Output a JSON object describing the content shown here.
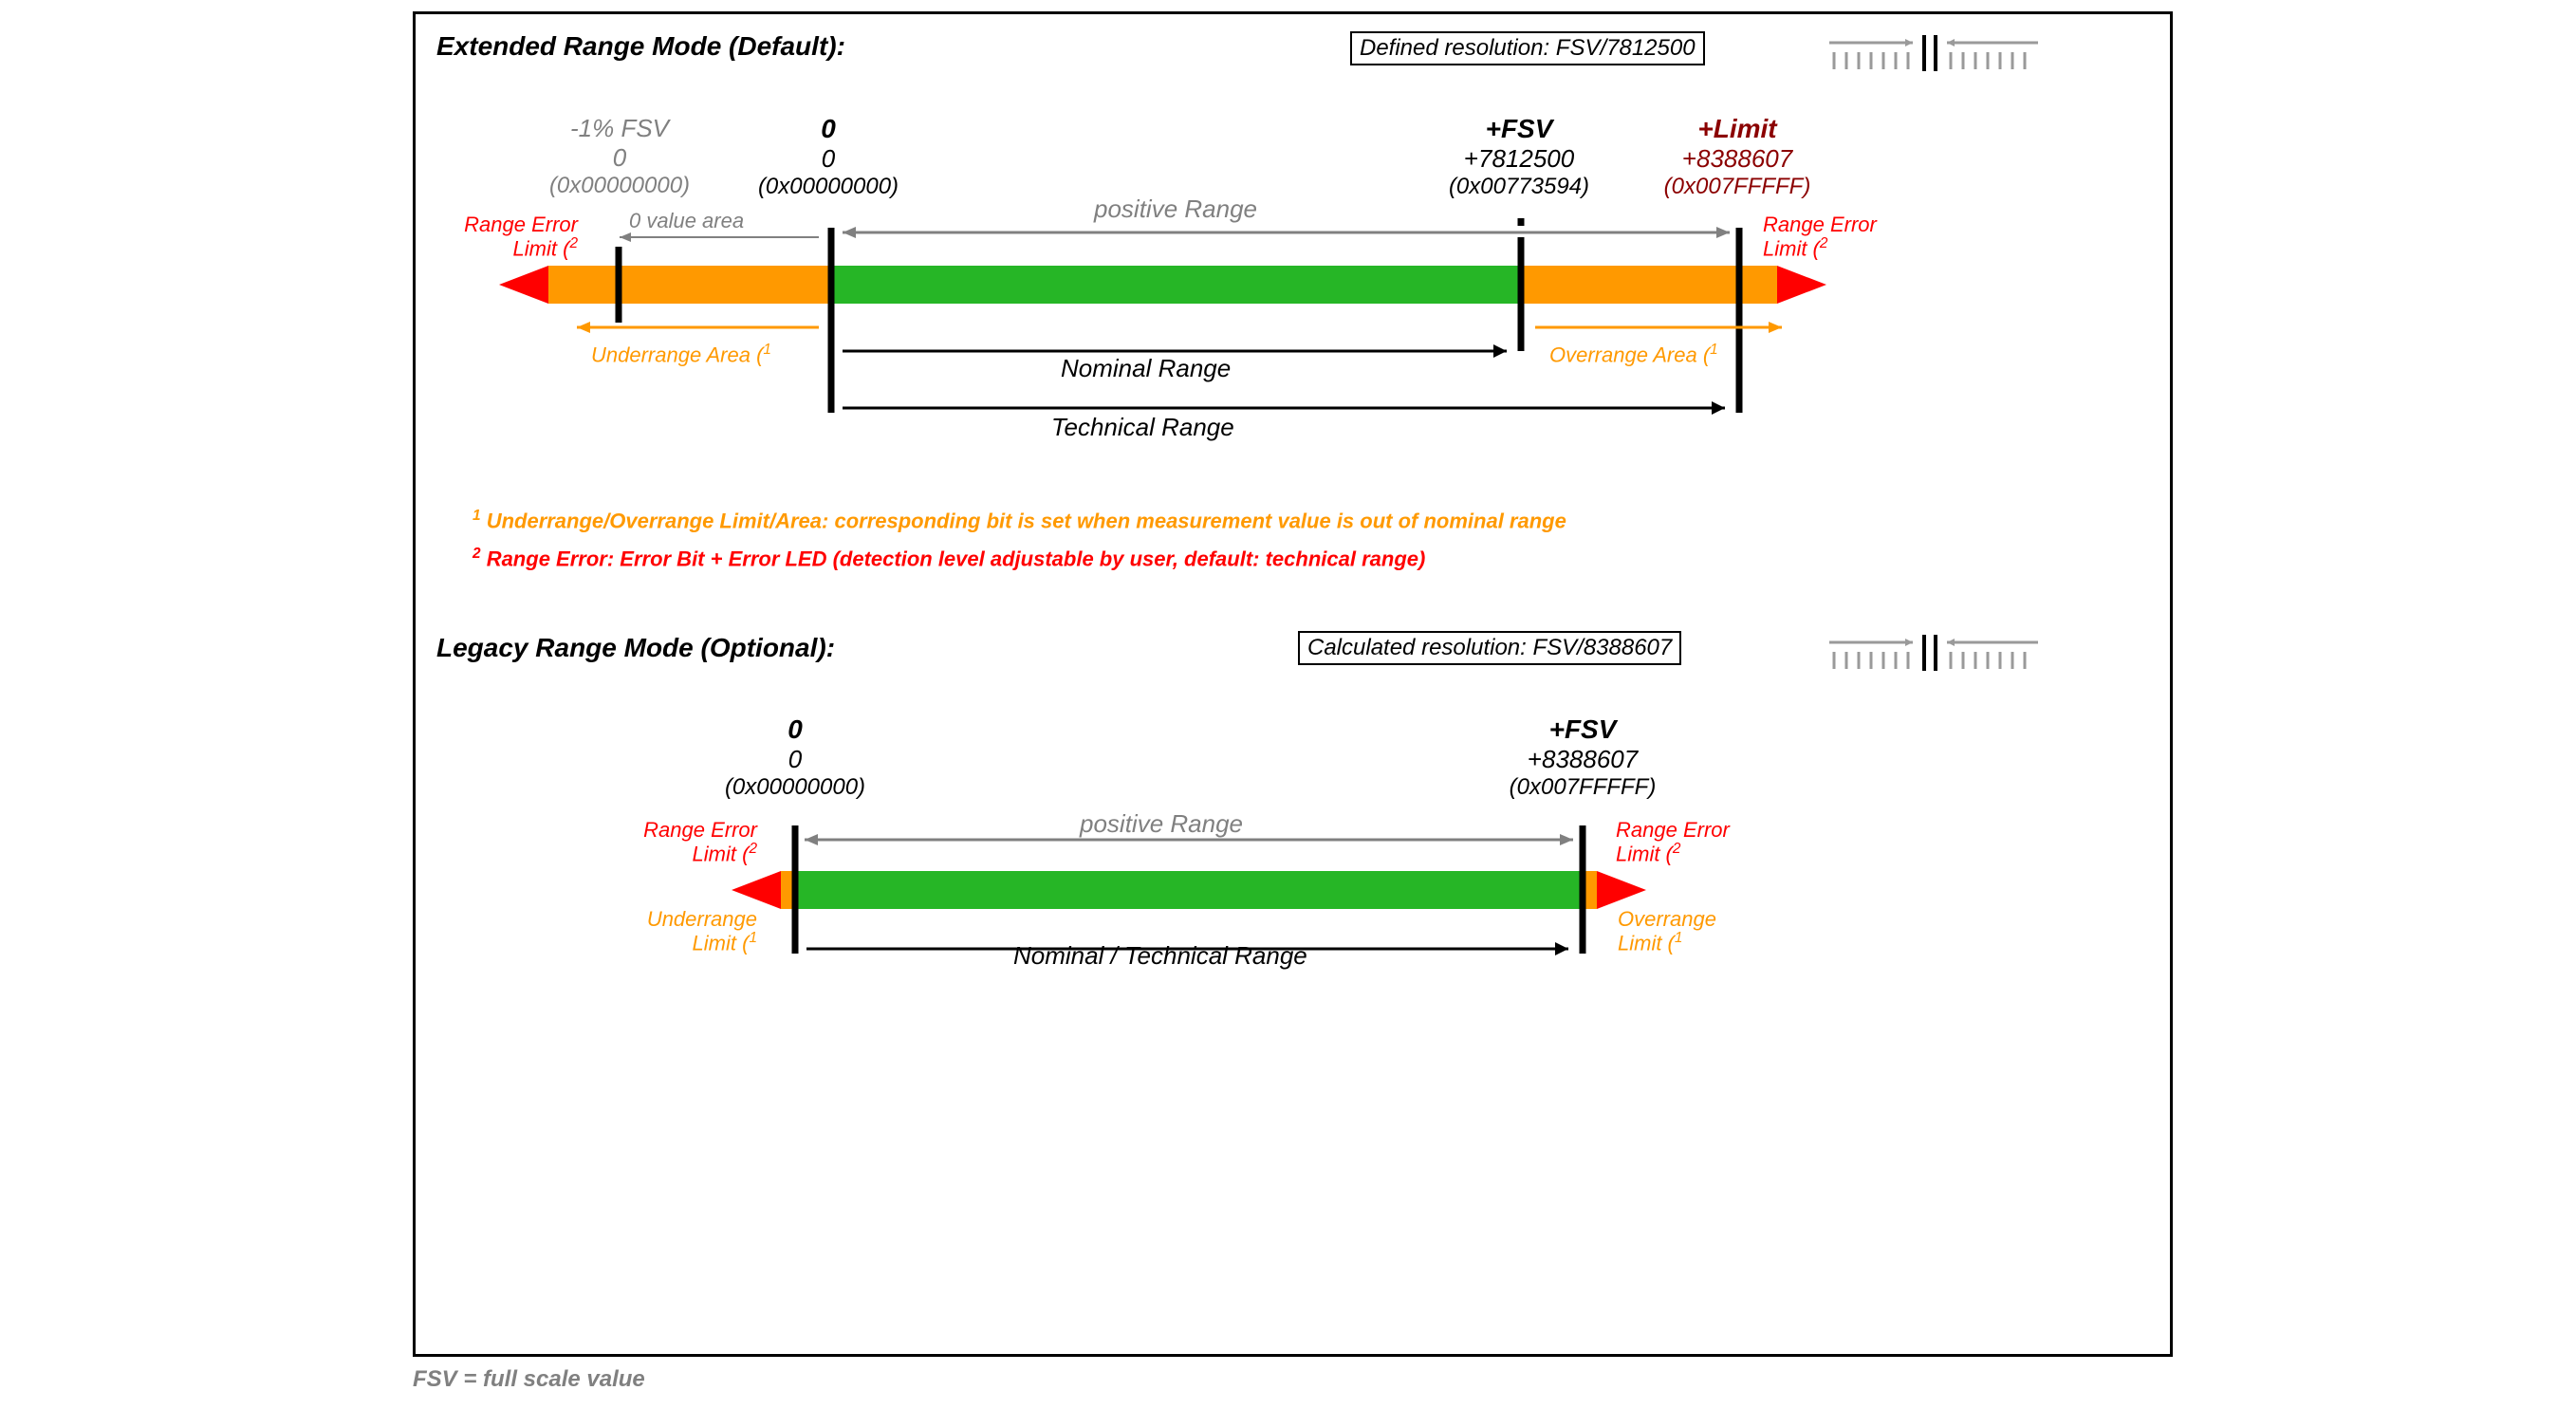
{
  "extended": {
    "title": "Extended Range Mode (Default):",
    "resolution_label": "Defined resolution: FSV/7812500",
    "marks": {
      "neg1fsv": {
        "label": "-1% FSV",
        "value": "0",
        "hex": "(0x00000000)"
      },
      "zero": {
        "label": "0",
        "value": "0",
        "hex": "(0x00000000)"
      },
      "fsv": {
        "label": "+FSV",
        "value": "+7812500",
        "hex": "(0x00773594)"
      },
      "limit": {
        "label": "+Limit",
        "value": "+8388607",
        "hex": "(0x007FFFFF)"
      }
    },
    "labels": {
      "range_error_limit_l": "Range Error\nLimit (",
      "range_error_limit_r": "Range Error\nLimit (",
      "zero_value_area": "0 value area",
      "positive_range": "positive Range",
      "underrange_area": "Underrange Area (",
      "overrange_area": "Overrange Area (",
      "nominal_range": "Nominal Range",
      "technical_range": "Technical Range"
    }
  },
  "footnotes": {
    "f1": "Underrange/Overrange Limit/Area: corresponding bit is set when measurement value is out of nominal range",
    "f2": "Range Error: Error Bit + Error LED (detection level adjustable by user, default: technical range)",
    "f1_marker": "1",
    "f2_marker": "2"
  },
  "legacy": {
    "title": "Legacy Range Mode (Optional):",
    "resolution_label": "Calculated resolution: FSV/8388607",
    "marks": {
      "zero": {
        "label": "0",
        "value": "0",
        "hex": "(0x00000000)"
      },
      "fsv": {
        "label": "+FSV",
        "value": "+8388607",
        "hex": "(0x007FFFFF)"
      }
    },
    "labels": {
      "range_error_limit_l": "Range Error\nLimit (",
      "range_error_limit_r": "Range Error\nLimit (",
      "underrange_limit": "Underrange\nLimit (",
      "overrange_limit": "Overrange\nLimit (",
      "positive_range": "positive Range",
      "nominal_technical_range": "Nominal / Technical Range"
    }
  },
  "footer": "FSV = full scale value",
  "colors": {
    "green": "#26b626",
    "orange": "#ff9900",
    "red": "#ff0000",
    "gray": "#808080",
    "maroon": "#8b0000"
  }
}
